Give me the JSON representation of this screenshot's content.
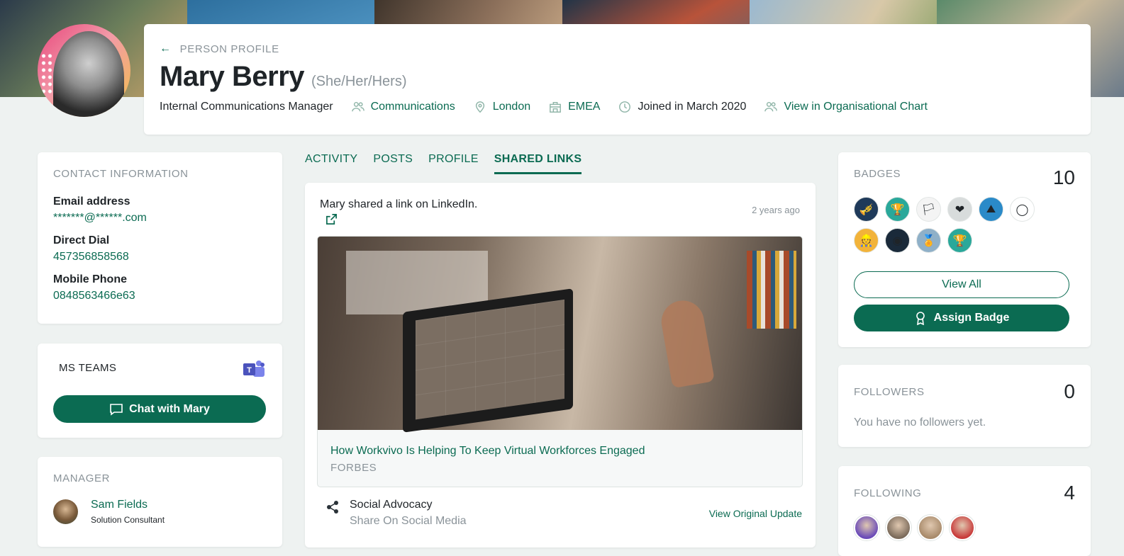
{
  "header": {
    "back_label": "PERSON PROFILE",
    "name": "Mary Berry",
    "pronouns": "(She/Her/Hers)",
    "job_title": "Internal Communications Manager",
    "department": "Communications",
    "location": "London",
    "region": "EMEA",
    "joined": "Joined in March 2020",
    "org_chart_link": "View in Organisational Chart"
  },
  "contact": {
    "title": "CONTACT INFORMATION",
    "email_label": "Email address",
    "email_value": "*******@******.com",
    "direct_label": "Direct Dial",
    "direct_value": "457356858568",
    "mobile_label": "Mobile Phone",
    "mobile_value": "0848563466e63"
  },
  "teams": {
    "title": "MS TEAMS",
    "chat_button": "Chat with Mary"
  },
  "manager": {
    "title": "MANAGER",
    "name": "Sam Fields",
    "role": "Solution Consultant"
  },
  "tabs": [
    {
      "label": "ACTIVITY",
      "active": false
    },
    {
      "label": "POSTS",
      "active": false
    },
    {
      "label": "PROFILE",
      "active": false
    },
    {
      "label": "SHARED LINKS",
      "active": true
    }
  ],
  "feed": {
    "author": "Mary",
    "action": " shared a link on LinkedIn.",
    "time": "2 years ago",
    "link_title": "How Workvivo Is Helping To Keep Virtual Workforces Engaged",
    "link_source": "FORBES",
    "advocacy_title": "Social Advocacy",
    "advocacy_sub": "Share On Social Media",
    "view_original": "View Original Update"
  },
  "badges": {
    "title": "BADGES",
    "count": "10",
    "items": [
      {
        "icon": "trumpet-badge-icon",
        "color": "#1f3a5a",
        "glyph": "🎺"
      },
      {
        "icon": "trophy-badge-icon",
        "color": "#2aa89a",
        "glyph": "🏆"
      },
      {
        "icon": "pride-flag-badge-icon",
        "color": "#f4f4f4",
        "glyph": "🏳"
      },
      {
        "icon": "heart-badge-icon",
        "color": "#d8dcdc",
        "glyph": "❤"
      },
      {
        "icon": "landscape-badge-icon",
        "color": "#2a8ac8",
        "glyph": "⛰"
      },
      {
        "icon": "olympic-rings-badge-icon",
        "color": "#ffffff",
        "glyph": "◯"
      },
      {
        "icon": "astronaut-badge-icon",
        "color": "#f2b33a",
        "glyph": "👷"
      },
      {
        "icon": "mind-badge-icon",
        "color": "#1a2a3a",
        "glyph": "◉"
      },
      {
        "icon": "medal-badge-icon",
        "color": "#8fb0c8",
        "glyph": "🏅"
      },
      {
        "icon": "cup-badge-icon",
        "color": "#2aa89a",
        "glyph": "🏆"
      }
    ],
    "view_all": "View All",
    "assign": "Assign Badge"
  },
  "followers": {
    "title": "FOLLOWERS",
    "count": "0",
    "empty": "You have no followers yet."
  },
  "following": {
    "title": "FOLLOWING",
    "count": "4",
    "avatars": [
      {
        "icon": "follower-avatar-1",
        "color": "#6a4ab8"
      },
      {
        "icon": "follower-avatar-2",
        "color": "#7a6a5a"
      },
      {
        "icon": "follower-avatar-3",
        "color": "#a88a6a"
      },
      {
        "icon": "follower-avatar-4",
        "color": "#c83a3a"
      }
    ]
  }
}
